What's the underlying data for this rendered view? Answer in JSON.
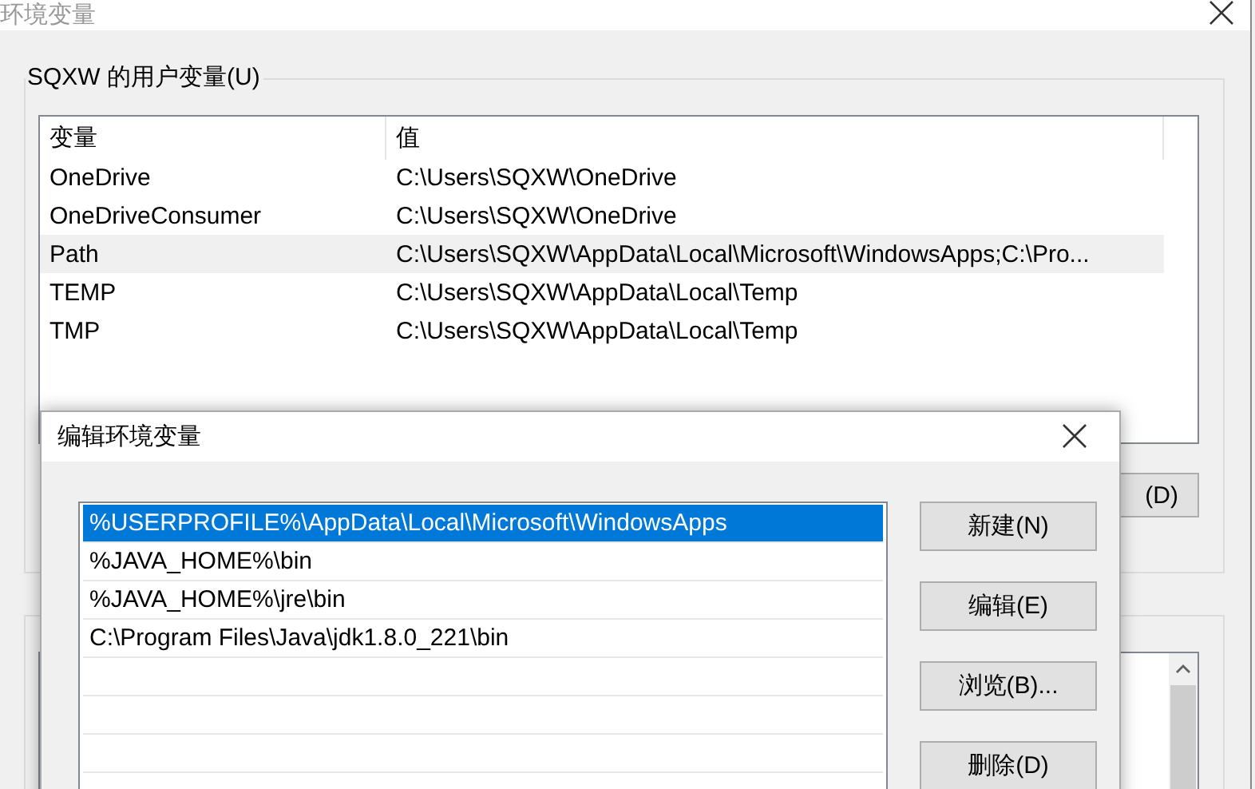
{
  "window": {
    "title": "环境变量"
  },
  "user_variables": {
    "label": "SQXW 的用户变量(U)",
    "columns": [
      "变量",
      "值"
    ],
    "rows": [
      {
        "name": "OneDrive",
        "value": "C:\\Users\\SQXW\\OneDrive",
        "selected": false
      },
      {
        "name": "OneDriveConsumer",
        "value": "C:\\Users\\SQXW\\OneDrive",
        "selected": false
      },
      {
        "name": "Path",
        "value": "C:\\Users\\SQXW\\AppData\\Local\\Microsoft\\WindowsApps;C:\\Pro...",
        "selected": true
      },
      {
        "name": "TEMP",
        "value": "C:\\Users\\SQXW\\AppData\\Local\\Temp",
        "selected": false
      },
      {
        "name": "TMP",
        "value": "C:\\Users\\SQXW\\AppData\\Local\\Temp",
        "selected": false
      }
    ],
    "button": "(D)"
  },
  "dialog": {
    "title": "编辑环境变量",
    "entries": [
      {
        "text": "%USERPROFILE%\\AppData\\Local\\Microsoft\\WindowsApps",
        "selected": true
      },
      {
        "text": "%JAVA_HOME%\\bin",
        "selected": false
      },
      {
        "text": "%JAVA_HOME%\\jre\\bin",
        "selected": false
      },
      {
        "text": "C:\\Program Files\\Java\\jdk1.8.0_221\\bin",
        "selected": false
      }
    ],
    "buttons": [
      "新建(N)",
      "编辑(E)",
      "浏览(B)...",
      "删除(D)"
    ]
  }
}
